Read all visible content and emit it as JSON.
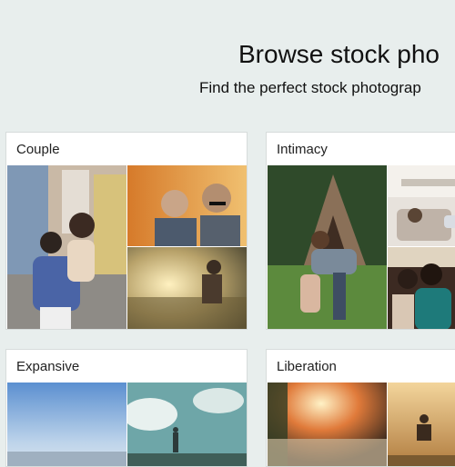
{
  "header": {
    "title": "Browse stock pho",
    "subtitle": "Find the perfect stock photograp"
  },
  "collections": [
    {
      "title": "Couple",
      "photos": [
        "couple-piggyback-street-photo",
        "couple-mustache-props-photo",
        "couple-water-sunset-photo"
      ]
    },
    {
      "title": "Intimacy",
      "photos": [
        "couple-kiss-outdoor-cabin-photo",
        "couple-living-room-photo",
        "couple-car-photo"
      ]
    },
    {
      "title": "Expansive",
      "photos": [
        "sky-horizon-photo",
        "person-clouds-sky-photo"
      ]
    },
    {
      "title": "Liberation",
      "photos": [
        "river-trees-sunlight-photo",
        "person-jumping-sunset-photo"
      ]
    }
  ],
  "colors": {
    "background": "#e8eeed",
    "card": "#ffffff",
    "card_border": "#d7dcdb",
    "text": "#111111"
  }
}
